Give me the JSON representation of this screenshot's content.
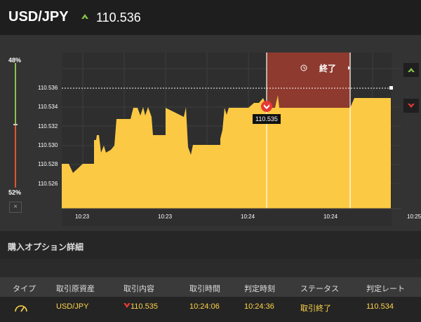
{
  "header": {
    "pair": "USD/JPY",
    "price": "110.536"
  },
  "gauge": {
    "top_pct": "48%",
    "bottom_pct": "52%",
    "close": "×"
  },
  "chart": {
    "y_ticks": [
      "110.536",
      "110.534",
      "110.532",
      "110.530",
      "110.528",
      "110.526"
    ],
    "x_ticks": [
      "10:23",
      "10:23",
      "10:24",
      "10:24",
      "10:25"
    ],
    "entry_label": "110.535",
    "expired_label": "終了",
    "colors": {
      "area": "#fbc943",
      "expired": "#8e3a2e",
      "up": "#8bc34a",
      "down": "#e53935"
    }
  },
  "details": {
    "title": "購入オプション詳細",
    "headers": [
      "タイプ",
      "取引原資産",
      "取引内容",
      "取引時間",
      "判定時刻",
      "ステータス",
      "判定レート"
    ],
    "row": {
      "asset": "USD/JPY",
      "content": "110.535",
      "time": "10:24:06",
      "judge_time": "10:24:36",
      "status": "取引終了",
      "rate": "110.534"
    }
  }
}
